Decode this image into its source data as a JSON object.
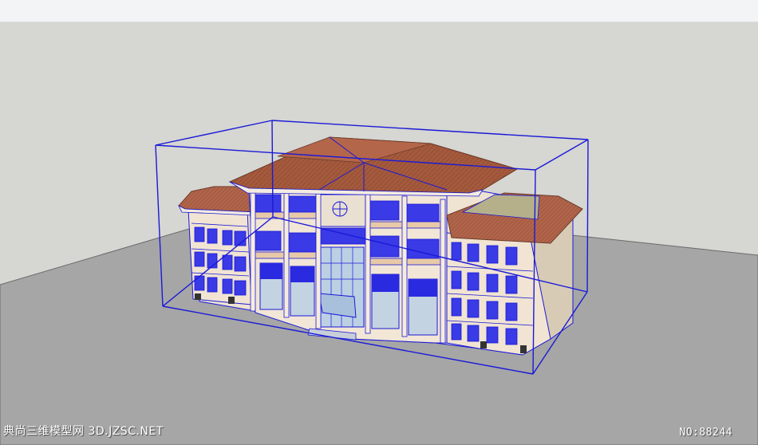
{
  "watermark": {
    "site_text": "典尚三维模型网 3D.JZSC.NET",
    "model_number": "NO:88244"
  },
  "colors": {
    "sky": "#d6d6d2",
    "ground": "#a6a6a6",
    "roof": "#a45a3c",
    "selection": "#1a1ad8",
    "facade": "#f1e6d8",
    "glass": "#2a2ae0"
  }
}
